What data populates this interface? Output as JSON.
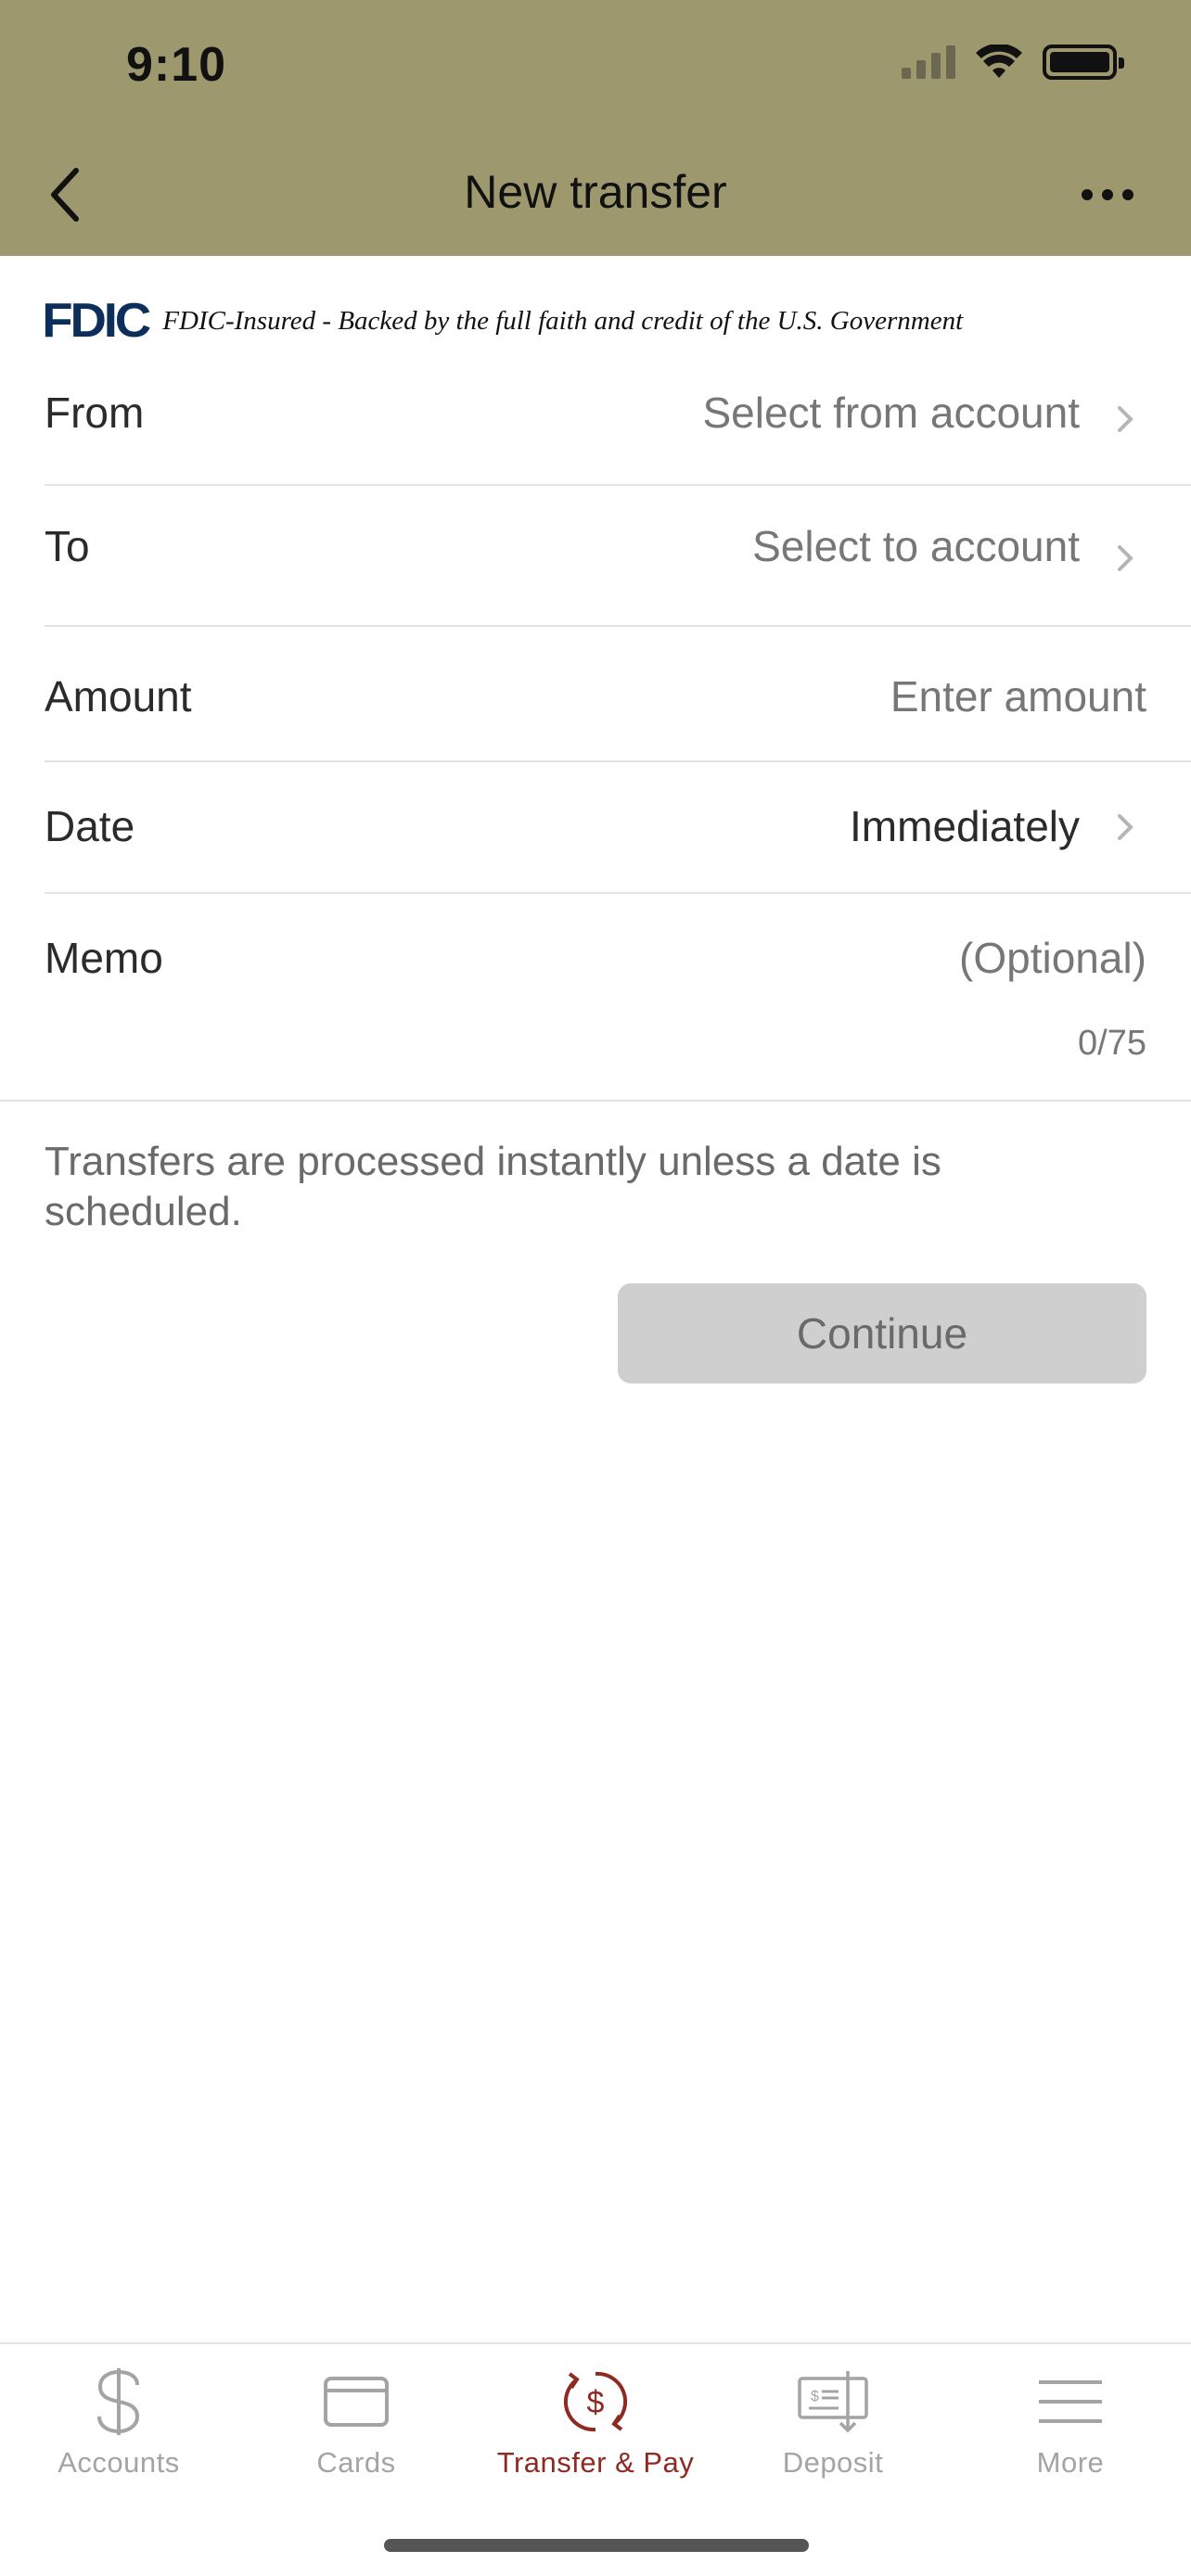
{
  "status_bar": {
    "time": "9:10"
  },
  "nav": {
    "title": "New transfer"
  },
  "fdic": {
    "logo": "FDIC",
    "text": "FDIC-Insured - Backed by the full faith and credit of the U.S. Government"
  },
  "form": {
    "from": {
      "label": "From",
      "value": "Select from account"
    },
    "to": {
      "label": "To",
      "value": "Select to account"
    },
    "amount": {
      "label": "Amount",
      "placeholder": "Enter amount"
    },
    "date": {
      "label": "Date",
      "value": "Immediately"
    },
    "memo": {
      "label": "Memo",
      "placeholder": "(Optional)",
      "counter": "0/75"
    }
  },
  "info": {
    "text": "Transfers are processed instantly unless a date is scheduled."
  },
  "continue_label": "Continue",
  "tabs": [
    {
      "label": "Accounts",
      "icon": "dollar-icon"
    },
    {
      "label": "Cards",
      "icon": "card-icon"
    },
    {
      "label": "Transfer & Pay",
      "icon": "transfer-icon",
      "active": true
    },
    {
      "label": "Deposit",
      "icon": "check-deposit-icon"
    },
    {
      "label": "More",
      "icon": "menu-icon"
    }
  ],
  "colors": {
    "header": "#9e986f",
    "active_tab": "#8f2a22",
    "inactive_tab": "#a4a4a4",
    "button_disabled": "#cfcfcf",
    "fdic_logo": "#0b2e5a"
  }
}
